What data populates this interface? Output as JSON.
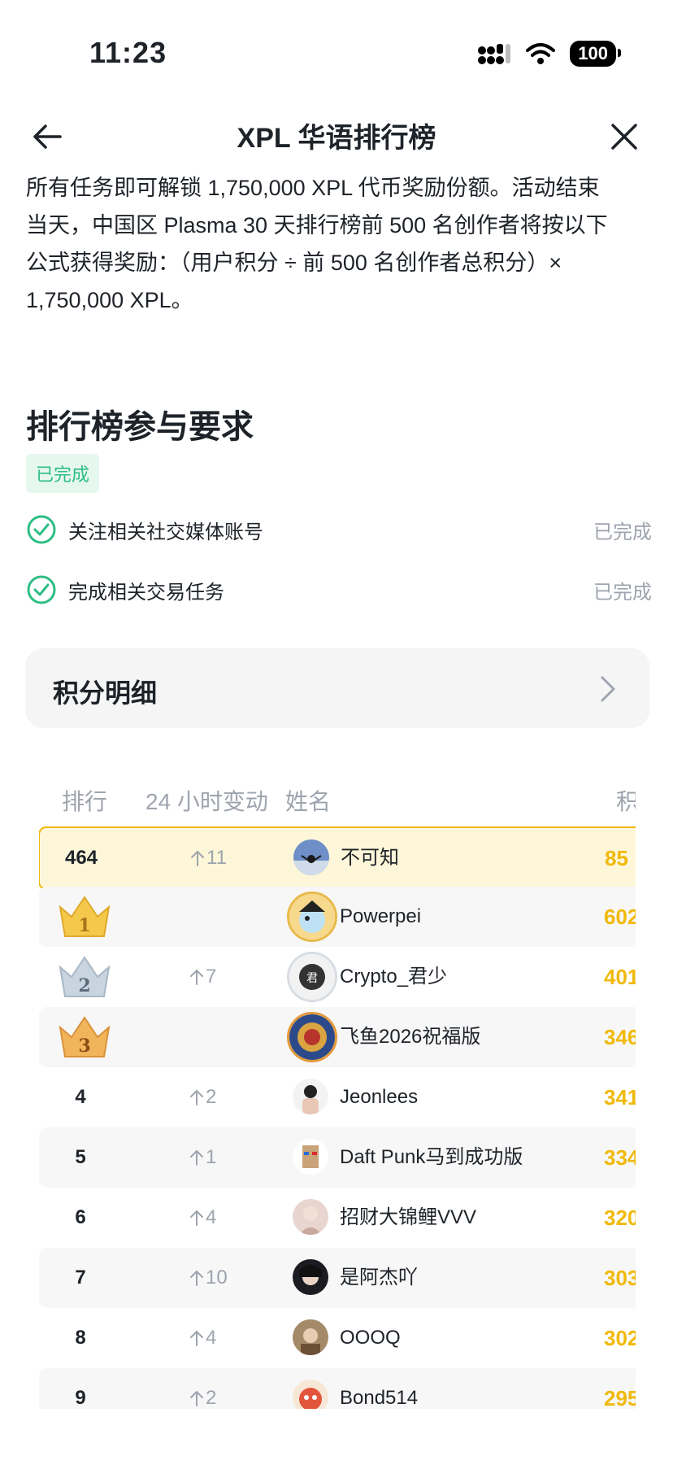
{
  "status_bar": {
    "time": "11:23",
    "battery": "100"
  },
  "nav": {
    "title": "XPL 华语排行榜"
  },
  "description": {
    "line1": "所有任务即可解锁 1,750,000 XPL 代币奖励份额。活动结束",
    "line2": "当天，中国区 Plasma 30 天排行榜前 500 名创作者将按以下",
    "line3": "公式获得奖励：（用户积分 ÷ 前 500 名创作者总积分）×",
    "line4": "1,750,000 XPL。"
  },
  "requirements": {
    "title": "排行榜参与要求",
    "badge": "已完成",
    "tasks": [
      {
        "label": "关注相关社交媒体账号",
        "status": "已完成"
      },
      {
        "label": "完成相关交易任务",
        "status": "已完成"
      }
    ]
  },
  "points_card": {
    "title": "积分明细"
  },
  "table": {
    "headers": {
      "rank": "排行",
      "change": "24 小时变动",
      "name": "姓名",
      "score": "积"
    },
    "my_row": {
      "rank": "464",
      "change": "11",
      "name": "不可知",
      "score": "85"
    },
    "rows": [
      {
        "rank": "1",
        "change": "",
        "name": "Powerpei",
        "score": "602"
      },
      {
        "rank": "2",
        "change": "7",
        "name": "Crypto_君少",
        "score": "401"
      },
      {
        "rank": "3",
        "change": "",
        "name": "飞鱼2026祝福版",
        "score": "346"
      },
      {
        "rank": "4",
        "change": "2",
        "name": "Jeonlees",
        "score": "341"
      },
      {
        "rank": "5",
        "change": "1",
        "name": "Daft Punk马到成功版",
        "score": "334"
      },
      {
        "rank": "6",
        "change": "4",
        "name": "招财大锦鲤VVV",
        "score": "320"
      },
      {
        "rank": "7",
        "change": "10",
        "name": "是阿杰吖",
        "score": "303"
      },
      {
        "rank": "8",
        "change": "4",
        "name": "OOOQ",
        "score": "302"
      },
      {
        "rank": "9",
        "change": "2",
        "name": "Bond514",
        "score": "295"
      }
    ]
  },
  "colors": {
    "accent": "#f0b90b",
    "success": "#2dbd85",
    "muted": "#9ea4ae",
    "text": "#1e2329"
  }
}
